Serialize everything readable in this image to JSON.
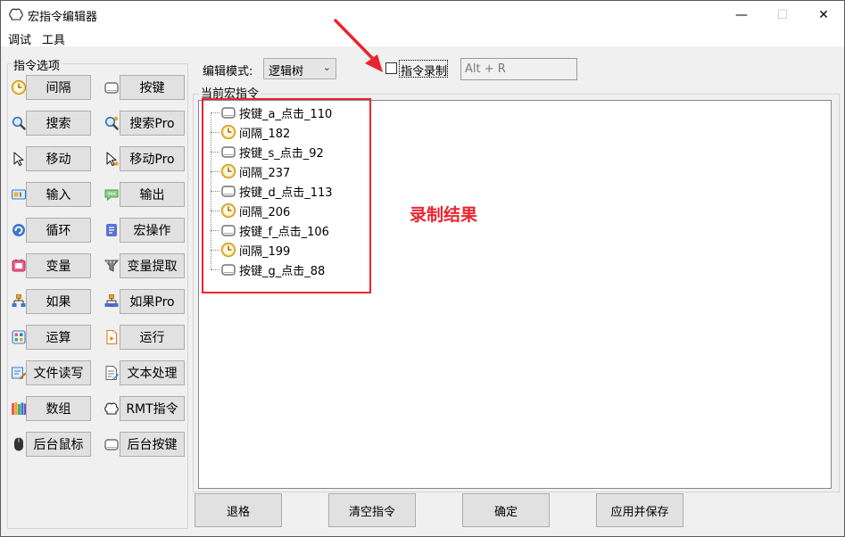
{
  "window": {
    "title": "宏指令编辑器",
    "minimize_glyph": "—",
    "maximize_glyph": "☐",
    "close_glyph": "✕"
  },
  "menu": [
    "调试",
    "工具"
  ],
  "command_panel": {
    "title": "指令选项",
    "rows": [
      [
        {
          "label": "间隔",
          "icon": "clock-icon"
        },
        {
          "label": "按键",
          "icon": "key-icon"
        }
      ],
      [
        {
          "label": "搜索",
          "icon": "magnifier-icon"
        },
        {
          "label": "搜索Pro",
          "icon": "magnifier-pro-icon"
        }
      ],
      [
        {
          "label": "移动",
          "icon": "cursor-icon"
        },
        {
          "label": "移动Pro",
          "icon": "cursor-pro-icon"
        }
      ],
      [
        {
          "label": "输入",
          "icon": "input-icon"
        },
        {
          "label": "输出",
          "icon": "chat-bubble-icon"
        }
      ],
      [
        {
          "label": "循环",
          "icon": "loop-icon"
        },
        {
          "label": "宏操作",
          "icon": "macro-icon"
        }
      ],
      [
        {
          "label": "变量",
          "icon": "variable-icon"
        },
        {
          "label": "变量提取",
          "icon": "funnel-icon"
        }
      ],
      [
        {
          "label": "如果",
          "icon": "branch-icon"
        },
        {
          "label": "如果Pro",
          "icon": "branch-pro-icon"
        }
      ],
      [
        {
          "label": "运算",
          "icon": "calculator-icon"
        },
        {
          "label": "运行",
          "icon": "run-file-icon"
        }
      ],
      [
        {
          "label": "文件读写",
          "icon": "file-edit-icon"
        },
        {
          "label": "文本处理",
          "icon": "text-edit-icon"
        }
      ],
      [
        {
          "label": "数组",
          "icon": "books-icon"
        },
        {
          "label": "RMT指令",
          "icon": "rmt-icon"
        }
      ],
      [
        {
          "label": "后台鼠标",
          "icon": "mouse-icon"
        },
        {
          "label": "后台按键",
          "icon": "key-icon"
        }
      ]
    ]
  },
  "editor": {
    "mode_label": "编辑模式:",
    "mode_value": "逻辑树",
    "record_label": "指令录制",
    "record_checked": false,
    "hotkey_value": "Alt + R",
    "tree_title": "当前宏指令",
    "nodes": [
      {
        "label": "按键_a_点击_110",
        "icon": "key-icon"
      },
      {
        "label": "间隔_182",
        "icon": "clock-icon"
      },
      {
        "label": "按键_s_点击_92",
        "icon": "key-icon"
      },
      {
        "label": "间隔_237",
        "icon": "clock-icon"
      },
      {
        "label": "按键_d_点击_113",
        "icon": "key-icon"
      },
      {
        "label": "间隔_206",
        "icon": "clock-icon"
      },
      {
        "label": "按键_f_点击_106",
        "icon": "key-icon"
      },
      {
        "label": "间隔_199",
        "icon": "clock-icon"
      },
      {
        "label": "按键_g_点击_88",
        "icon": "key-icon"
      }
    ]
  },
  "annotation": {
    "text": "录制结果",
    "color": "#e8252f"
  },
  "footer_buttons": [
    "退格",
    "清空指令",
    "确定",
    "应用并保存"
  ],
  "colors": {
    "accent_red": "#e8252f",
    "button_face": "#e1e1e1",
    "button_border": "#adadad",
    "window_bg": "#f0f0f0"
  }
}
